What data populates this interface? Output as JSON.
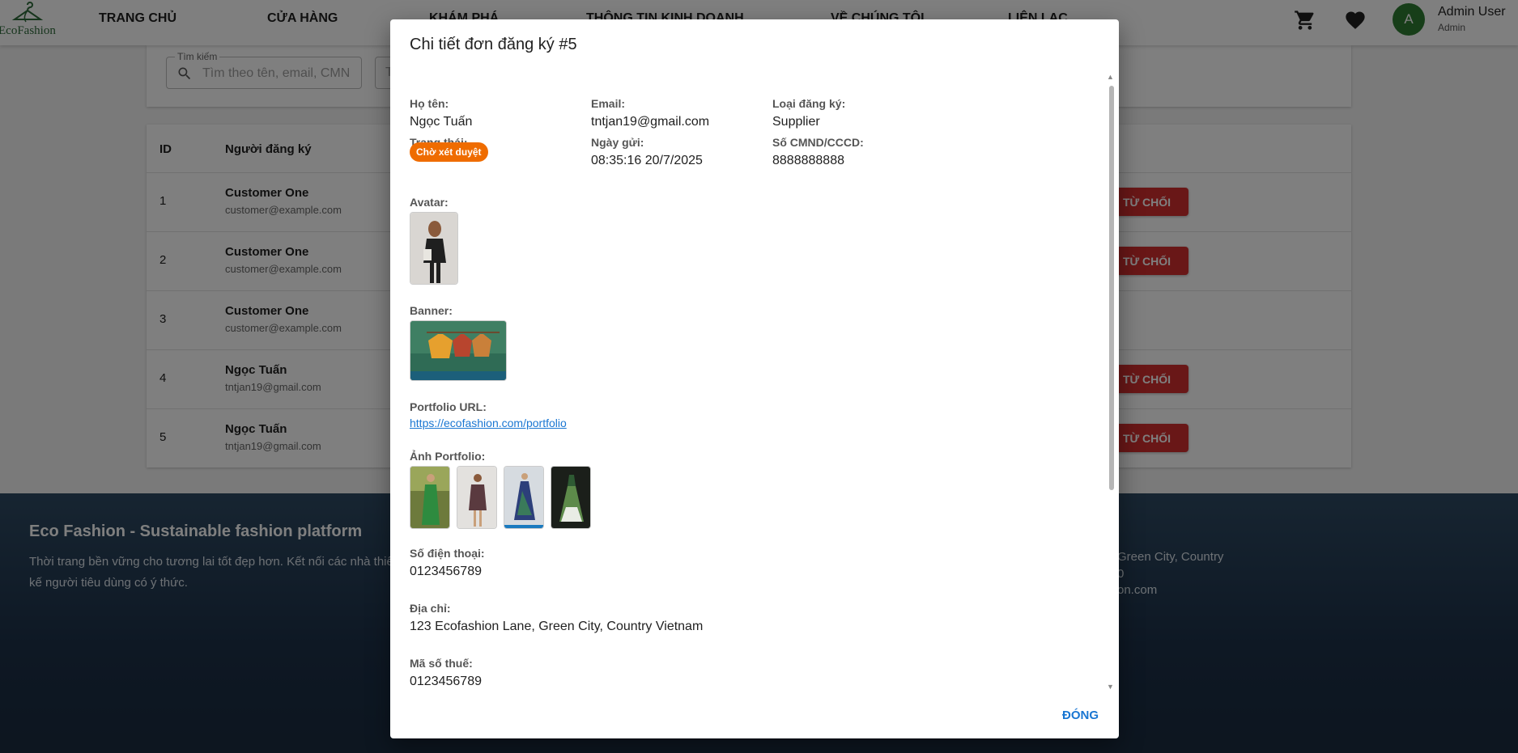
{
  "header": {
    "logo_text": "EcoFashion",
    "nav": [
      "TRANG CHỦ",
      "CỬA HÀNG",
      "KHÁM PHÁ",
      "THÔNG TIN KINH DOANH",
      "VỀ CHÚNG TÔI",
      "LIÊN LẠC"
    ],
    "user": {
      "initial": "A",
      "name": "Admin User",
      "role": "Admin"
    }
  },
  "search": {
    "legend": "Tìm kiếm",
    "placeholder": "Tìm theo tên, email, CMN",
    "second_field_text": "T"
  },
  "table": {
    "headers": {
      "id": "ID",
      "applicant": "Người đăng ký"
    },
    "reject_label": "TỪ CHỐI",
    "rows": [
      {
        "id": "1",
        "name": "Customer One",
        "email": "customer@example.com",
        "has_reject": true
      },
      {
        "id": "2",
        "name": "Customer One",
        "email": "customer@example.com",
        "has_reject": true
      },
      {
        "id": "3",
        "name": "Customer One",
        "email": "customer@example.com",
        "has_reject": false
      },
      {
        "id": "4",
        "name": "Ngọc Tuấn",
        "email": "tntjan19@gmail.com",
        "has_reject": true
      },
      {
        "id": "5",
        "name": "Ngọc Tuấn",
        "email": "tntjan19@gmail.com",
        "has_reject": true
      }
    ]
  },
  "footer": {
    "title": "Eco Fashion - Sustainable fashion platform",
    "description": "Thời trang bền vững cho tương lai tốt đẹp hơn. Kết nối các nhà thiết kế người tiêu dùng có ý thức.",
    "address_fragment": "Green City, Country",
    "line2_fragment": "0",
    "email_fragment": "on.com"
  },
  "modal": {
    "title": "Chi tiết đơn đăng ký #5",
    "fields": {
      "fullname_label": "Họ tên:",
      "fullname": "Ngọc Tuấn",
      "email_label": "Email:",
      "email": "tntjan19@gmail.com",
      "type_label": "Loại đăng ký:",
      "type": "Supplier",
      "status_label": "Trạng thái:",
      "status": "Chờ xét duyệt",
      "date_label": "Ngày gửi:",
      "date": "08:35:16 20/7/2025",
      "id_label": "Số CMND/CCCD:",
      "id_number": "8888888888",
      "avatar_label": "Avatar:",
      "banner_label": "Banner:",
      "portfolio_url_label": "Portfolio URL:",
      "portfolio_url": "https://ecofashion.com/portfolio",
      "portfolio_images_label": "Ảnh Portfolio:",
      "phone_label": "Số điện thoại:",
      "phone": "0123456789",
      "address_label": "Địa chỉ:",
      "address": "123 Ecofashion Lane, Green City, Country Vietnam",
      "tax_label": "Mã số thuế:",
      "tax": "0123456789"
    },
    "close_label": "Đóng"
  },
  "colors": {
    "reject": "#d32f2f",
    "status_chip": "#ef6c00",
    "link": "#1976d2",
    "avatar": "#2e7d32",
    "footer": "#1c3048"
  }
}
